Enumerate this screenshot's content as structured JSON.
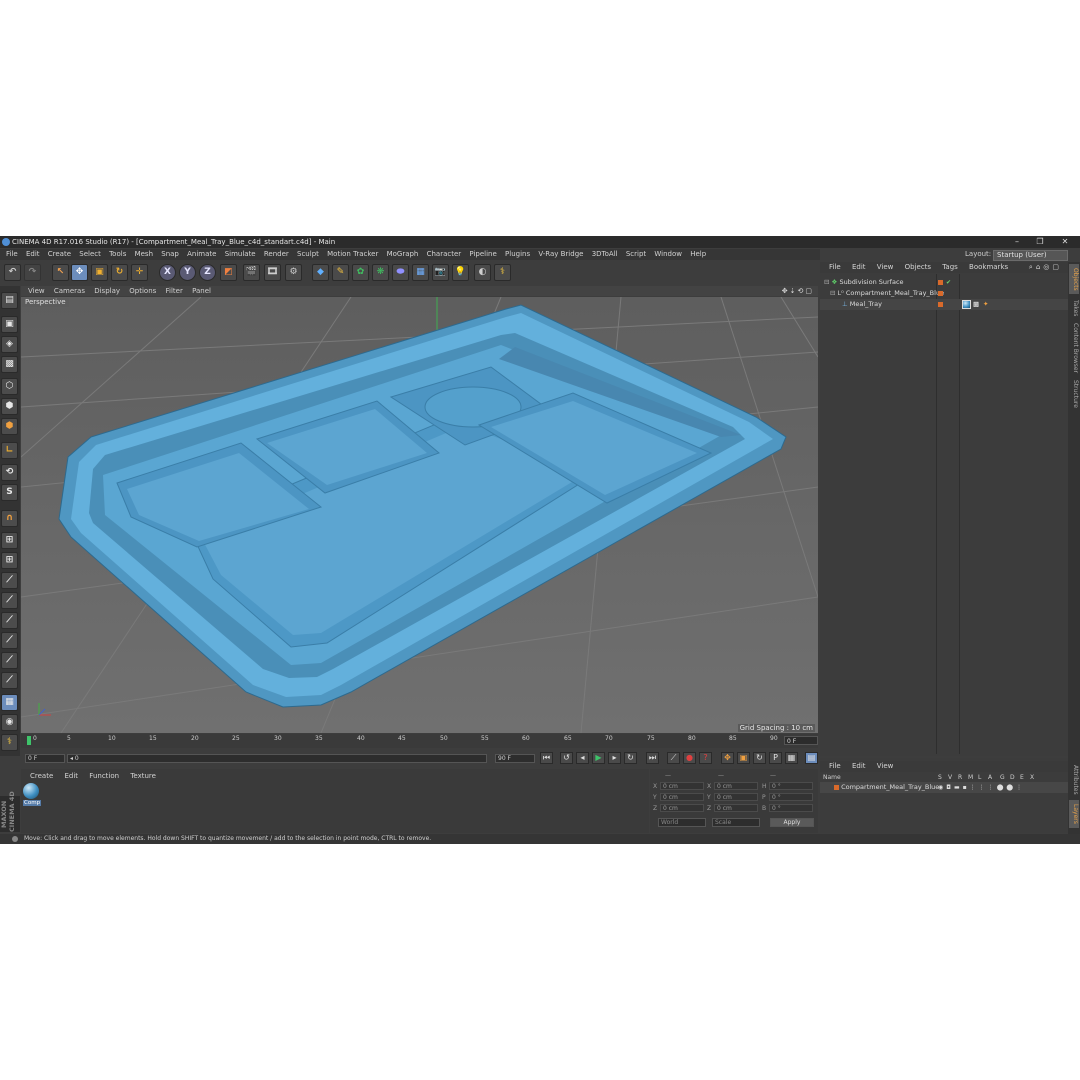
{
  "window": {
    "title": "CINEMA 4D R17.016 Studio (R17) - [Compartment_Meal_Tray_Blue_c4d_standart.c4d] - Main",
    "controls": [
      "–",
      "❐",
      "✕"
    ]
  },
  "menu": [
    "File",
    "Edit",
    "Create",
    "Select",
    "Tools",
    "Mesh",
    "Snap",
    "Animate",
    "Simulate",
    "Render",
    "Sculpt",
    "Motion Tracker",
    "MoGraph",
    "Character",
    "Pipeline",
    "Plugins",
    "V-Ray Bridge",
    "3DToAll",
    "Script",
    "Window",
    "Help"
  ],
  "layout": {
    "label": "Layout:",
    "value": "Startup (User)"
  },
  "toolbar": {
    "axis_x": "X",
    "axis_y": "Y",
    "axis_z": "Z"
  },
  "left_tools": {
    "s_label": "S"
  },
  "viewport": {
    "menu": [
      "View",
      "Cameras",
      "Display",
      "Options",
      "Filter",
      "Panel"
    ],
    "label": "Perspective",
    "grid_spacing": "Grid Spacing : 10 cm",
    "model_color": "#5ba9d4"
  },
  "timeline": {
    "ticks": [
      "0",
      "5",
      "10",
      "15",
      "20",
      "25",
      "30",
      "35",
      "40",
      "45",
      "50",
      "55",
      "60",
      "65",
      "70",
      "75",
      "80",
      "85",
      "90"
    ],
    "current_frame": "0 F"
  },
  "transport": {
    "start": "0 F",
    "range_min": "◂ 0",
    "range_end": "90 F",
    "end": "90 F"
  },
  "material_panel": {
    "menu": [
      "Create",
      "Edit",
      "Function",
      "Texture"
    ],
    "material_name": "Comp"
  },
  "coordinates": {
    "rows": [
      {
        "a": "X",
        "av": "0 cm",
        "b": "X",
        "bv": "0 cm",
        "c": "H",
        "cv": "0 °"
      },
      {
        "a": "Y",
        "av": "0 cm",
        "b": "Y",
        "bv": "0 cm",
        "c": "P",
        "cv": "0 °"
      },
      {
        "a": "Z",
        "av": "0 cm",
        "b": "Z",
        "bv": "0 cm",
        "c": "B",
        "cv": "0 °"
      }
    ],
    "mode_world": "World",
    "mode_scale": "Scale",
    "apply": "Apply",
    "headers": [
      "—",
      "—",
      "—"
    ]
  },
  "object_manager": {
    "menu": [
      "File",
      "Edit",
      "View",
      "Objects",
      "Tags",
      "Bookmarks"
    ],
    "objects": [
      "Subdivision Surface",
      "Compartment_Meal_Tray_Blue",
      "Meal_Tray"
    ]
  },
  "attribute_manager": {
    "menu": [
      "File",
      "Edit",
      "View"
    ],
    "columns": [
      "Name",
      "S",
      "V",
      "R",
      "M",
      "L",
      "A",
      "G",
      "D",
      "E",
      "X"
    ],
    "row_name": "Compartment_Meal_Tray_Blue"
  },
  "right_tabs": [
    "Objects",
    "Takes",
    "Content Browser",
    "Structure",
    "Attributes",
    "Layers"
  ],
  "maxon": "MAXON\nCINEMA 4D",
  "status": "Move: Click and drag to move elements. Hold down SHIFT to quantize movement / add to the selection in point mode, CTRL to remove."
}
